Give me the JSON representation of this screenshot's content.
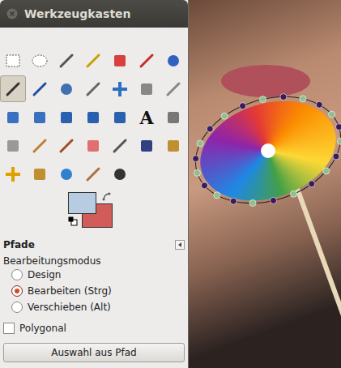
{
  "window": {
    "title": "Werkzeugkasten"
  },
  "tools": [
    {
      "kind": "rect-select",
      "selected": false
    },
    {
      "kind": "ellipse-select",
      "selected": false
    },
    {
      "kind": "free-select",
      "selected": false
    },
    {
      "kind": "fuzzy-select",
      "selected": false
    },
    {
      "kind": "color-select",
      "selected": false
    },
    {
      "kind": "scissors",
      "selected": false
    },
    {
      "kind": "foreground-select",
      "selected": false
    },
    {
      "kind": "paths",
      "selected": true
    },
    {
      "kind": "color-picker",
      "selected": false
    },
    {
      "kind": "zoom",
      "selected": false
    },
    {
      "kind": "measure",
      "selected": false
    },
    {
      "kind": "move",
      "selected": false
    },
    {
      "kind": "align",
      "selected": false
    },
    {
      "kind": "crop",
      "selected": false
    },
    {
      "kind": "rotate",
      "selected": false
    },
    {
      "kind": "scale",
      "selected": false
    },
    {
      "kind": "shear",
      "selected": false
    },
    {
      "kind": "perspective",
      "selected": false
    },
    {
      "kind": "flip",
      "selected": false
    },
    {
      "kind": "text",
      "glyph": "A",
      "selected": false
    },
    {
      "kind": "bucket",
      "selected": false
    },
    {
      "kind": "blend",
      "selected": false
    },
    {
      "kind": "pencil",
      "selected": false
    },
    {
      "kind": "brush",
      "selected": false
    },
    {
      "kind": "eraser",
      "selected": false
    },
    {
      "kind": "airbrush",
      "selected": false
    },
    {
      "kind": "ink",
      "selected": false
    },
    {
      "kind": "clone",
      "selected": false
    },
    {
      "kind": "heal",
      "selected": false
    },
    {
      "kind": "perspective-clone",
      "selected": false
    },
    {
      "kind": "blur",
      "selected": false
    },
    {
      "kind": "smudge",
      "selected": false
    },
    {
      "kind": "dodge",
      "selected": false
    }
  ],
  "colors": {
    "foreground": "#b7cce0",
    "background": "#d15c5a"
  },
  "options": {
    "title": "Pfade",
    "section": "Bearbeitungsmodus",
    "modes": [
      {
        "label": "Design",
        "selected": false
      },
      {
        "label": "Bearbeiten (Strg)",
        "selected": true
      },
      {
        "label": "Verschieben (Alt)",
        "selected": false
      }
    ],
    "polygonal": {
      "label": "Polygonal",
      "checked": false
    },
    "button": "Auswahl aus Pfad"
  }
}
